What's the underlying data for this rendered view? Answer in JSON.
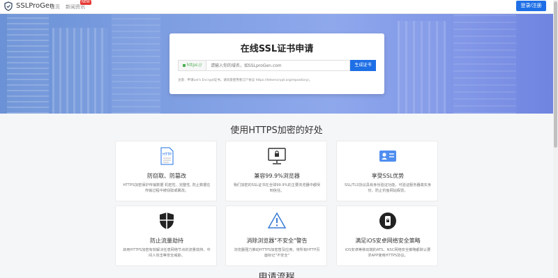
{
  "nav": {
    "logo_text": "SSLProGen",
    "home": "首页",
    "news": "新闻资讯",
    "news_badge": "NEW",
    "login": "登录/注册"
  },
  "hero": {
    "title": "在线SSL证书申请",
    "prefix": "https://",
    "placeholder": "请输入你的域名，如SSLproGen.com",
    "button": "生成证书",
    "note": "注意：申请Let's Encrypt证书，请同意使用者订户协议 https://letsencrypt.org/repository/。"
  },
  "section": {
    "title": "使用HTTPS加密的好处"
  },
  "features": [
    {
      "title": "防窃取、防篡改",
      "desc": "HTTPS加密保护传输数据 机密性、完整性, 防止数据在传输过程中被窃取或篡改。",
      "icon": "https-document-icon"
    },
    {
      "title": "兼容99.9%浏览器",
      "desc": "我们加密的SSL证书在全球99.9%的主要浏览器中都受到信任。",
      "icon": "monitor-lock-icon"
    },
    {
      "title": "享受SSL优势",
      "desc": "SSL/TLS协议具有身份验证功能，可验证服务器真实身份，防止钓鱼网站假冒。",
      "icon": "id-card-icon"
    },
    {
      "title": "防止流量劫持",
      "desc": "启用HTTPS加密有效解决任意网络节点的流量劫持、中间人攻击等安全威胁。",
      "icon": "shield-icon"
    },
    {
      "title": "消除浏览器\"不安全\"警告",
      "desc": "浏览器强力推动HTTPS加密普及应用，将所有HTTP页面标记\"不安全\"",
      "icon": "warning-icon"
    },
    {
      "title": "满足iOS安卓网络安全策略",
      "desc": "iOS安卓等移动端的ATS、NSC网络安全策略都默认要求APP使用HTTPS协议。",
      "icon": "phone-lock-icon"
    }
  ],
  "tail": {
    "heading": "申请流程"
  },
  "colors": {
    "primary": "#1e6fe6",
    "hero_start": "#6b92d6",
    "hero_end": "#6f84e0"
  }
}
